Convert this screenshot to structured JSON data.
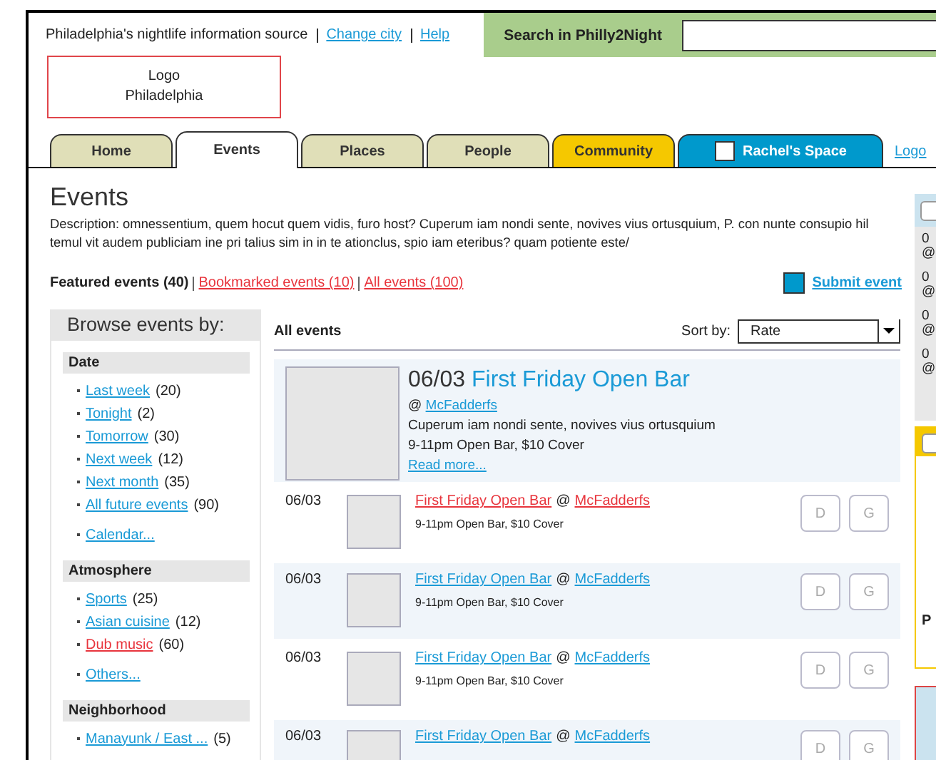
{
  "header": {
    "tagline": "Philadelphia's nightlife information source",
    "links": [
      {
        "label": "Change city"
      },
      {
        "label": "Help"
      }
    ],
    "search": {
      "label": "Search in Philly2Night"
    }
  },
  "logo": {
    "lines": [
      "Logo",
      "Philadelphia"
    ]
  },
  "tabs": [
    {
      "label": "Home",
      "selected": false,
      "color": "#e0dfb8",
      "kind": "plain"
    },
    {
      "label": "Events",
      "selected": true,
      "color": "#ffffff",
      "kind": "plain"
    },
    {
      "label": "Places",
      "selected": false,
      "color": "#e0dfb8",
      "kind": "plain"
    },
    {
      "label": "People",
      "selected": false,
      "color": "#e0dfb8",
      "kind": "plain"
    },
    {
      "label": "Community",
      "selected": false,
      "color": "#f5c800",
      "kind": "plain"
    },
    {
      "label": "Rachel's Space",
      "selected": false,
      "color": "#0099cc",
      "kind": "personal"
    }
  ],
  "logout": {
    "label": "Logo"
  },
  "page": {
    "title": "Events",
    "description": "Description: omnessentium, quem hocut quem vidis, furo host? Cuperum iam nondi sente, novives vius ortusquium, P. con nunte consupio hil temul vit audem publiciam ine pri talius sim in in te ationclus, spio iam eteribus? quam potiente este/"
  },
  "filters": [
    {
      "label": "Featured events (40)",
      "selected": true
    },
    {
      "label": "Bookmarked events (10)",
      "selected": false
    },
    {
      "label": "All events (100)",
      "selected": false
    }
  ],
  "submit": {
    "label": "Submit event"
  },
  "sidebar": {
    "title": "Browse events by:",
    "groups": [
      {
        "title": "Date",
        "items": [
          {
            "label": "Last week",
            "count": "(20)",
            "visited": false
          },
          {
            "label": "Tonight",
            "count": "(2)",
            "visited": false
          },
          {
            "label": "Tomorrow",
            "count": "(30)",
            "visited": false
          },
          {
            "label": "Next week",
            "count": "(12)",
            "visited": false
          },
          {
            "label": "Next month",
            "count": "(35)",
            "visited": false
          },
          {
            "label": "All future events",
            "count": "(90)",
            "visited": false
          }
        ],
        "more": "Calendar..."
      },
      {
        "title": "Atmosphere",
        "items": [
          {
            "label": "Sports",
            "count": "(25)",
            "visited": false
          },
          {
            "label": "Asian cuisine",
            "count": "(12)",
            "visited": false
          },
          {
            "label": "Dub music",
            "count": "(60)",
            "visited": true
          }
        ],
        "more": "Others..."
      },
      {
        "title": "Neighborhood",
        "items": [
          {
            "label": "Manayunk / East ...",
            "count": "(5)",
            "visited": false
          }
        ]
      }
    ]
  },
  "list": {
    "title": "All events",
    "sort_label": "Sort by:",
    "sort_value": "Rate",
    "featured": {
      "date": "06/03",
      "title": "First Friday Open Bar",
      "at": "@",
      "venue": "McFadderfs",
      "description": "Cuperum iam nondi sente, novives vius ortusquium",
      "time": "9-11pm Open Bar, $10 Cover",
      "more": "Read more..."
    },
    "rows": [
      {
        "date": "06/03",
        "title": "First Friday Open Bar",
        "at": "@",
        "venue": "McFadderfs",
        "time": "9-11pm Open Bar, $10 Cover",
        "visited": true,
        "buttons": [
          "D",
          "G"
        ]
      },
      {
        "date": "06/03",
        "title": "First Friday Open Bar",
        "at": "@",
        "venue": "McFadderfs",
        "time": "9-11pm Open Bar, $10 Cover",
        "visited": false,
        "buttons": [
          "D",
          "G"
        ]
      },
      {
        "date": "06/03",
        "title": "First Friday Open Bar",
        "at": "@",
        "venue": "McFadderfs",
        "time": "9-11pm Open Bar, $10 Cover",
        "visited": false,
        "buttons": [
          "D",
          "G"
        ]
      },
      {
        "date": "06/03",
        "title": "First Friday Open Bar",
        "at": "@",
        "venue": "McFadderfs",
        "visited": false,
        "buttons": [
          "D",
          "G"
        ]
      }
    ]
  },
  "right": {
    "items": [
      {
        "line_1": "0",
        "line_2": "@"
      },
      {
        "line_1": "0",
        "line_2": "@"
      },
      {
        "line_1": "0",
        "line_2": "@"
      },
      {
        "line_1": "0",
        "line_2": "@"
      }
    ],
    "box_text": "P"
  }
}
